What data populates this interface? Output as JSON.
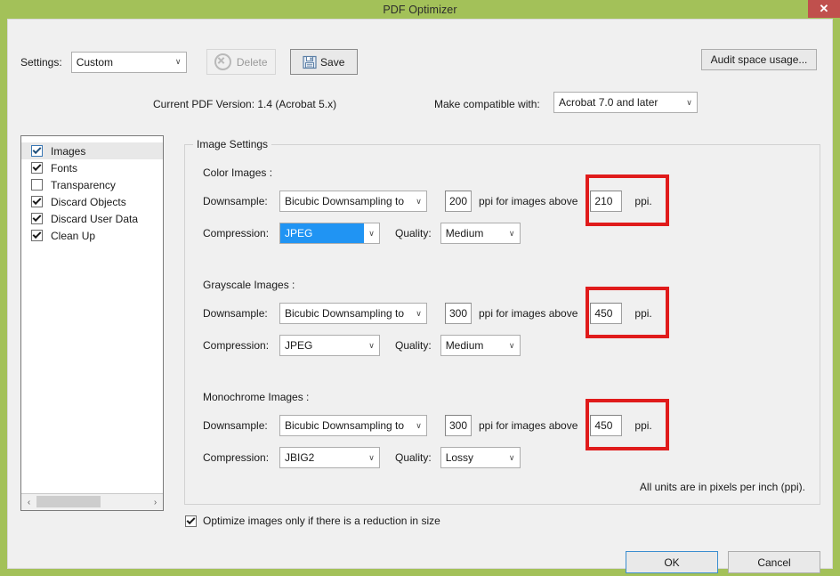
{
  "window": {
    "title": "PDF Optimizer",
    "close_label": "✕",
    "frame_color": "#a3c159",
    "close_color": "#c0504d"
  },
  "toolbar": {
    "settings_label": "Settings:",
    "settings_value": "Custom",
    "delete_label": "Delete",
    "delete_icon": "cancel-circle-icon",
    "save_label": "Save",
    "save_icon": "floppy-disk-icon",
    "audit_label": "Audit space usage..."
  },
  "version": {
    "current_text": "Current PDF Version: 1.4 (Acrobat 5.x)",
    "compat_label": "Make compatible with:",
    "compat_value": "Acrobat 7.0 and later"
  },
  "panel": {
    "items": [
      {
        "label": "Images",
        "checked": true,
        "selected": true
      },
      {
        "label": "Fonts",
        "checked": true,
        "selected": false
      },
      {
        "label": "Transparency",
        "checked": false,
        "selected": false
      },
      {
        "label": "Discard Objects",
        "checked": true,
        "selected": false
      },
      {
        "label": "Discard User Data",
        "checked": true,
        "selected": false
      },
      {
        "label": "Clean Up",
        "checked": true,
        "selected": false
      }
    ],
    "scroll_left": "‹",
    "scroll_right": "›"
  },
  "image_settings": {
    "legend": "Image Settings",
    "downsample_label": "Downsample:",
    "compression_label": "Compression:",
    "quality_label": "Quality:",
    "ppi_mid_text": "ppi for images above",
    "ppi_suffix": "ppi.",
    "units_note": "All units are in pixels per inch (ppi).",
    "sections": [
      {
        "title": "Color Images :",
        "downsample_method": "Bicubic Downsampling to",
        "downsample_ppi": "200",
        "threshold_ppi": "210",
        "compression": "JPEG",
        "compression_selected": true,
        "quality": "Medium",
        "highlighted": true
      },
      {
        "title": "Grayscale Images :",
        "downsample_method": "Bicubic Downsampling to",
        "downsample_ppi": "300",
        "threshold_ppi": "450",
        "compression": "JPEG",
        "compression_selected": false,
        "quality": "Medium",
        "highlighted": true
      },
      {
        "title": "Monochrome Images :",
        "downsample_method": "Bicubic Downsampling to",
        "downsample_ppi": "300",
        "threshold_ppi": "450",
        "compression": "JBIG2",
        "compression_selected": false,
        "quality": "Lossy",
        "highlighted": true
      }
    ]
  },
  "footer": {
    "optimize_label": "Optimize images only if there is a reduction in size",
    "optimize_checked": true,
    "ok_label": "OK",
    "cancel_label": "Cancel"
  },
  "colors": {
    "selection_blue": "#2094f3",
    "annotation_red": "#e01b1b",
    "title_green": "#a3c159"
  },
  "icons": {
    "combo_arrow": "∨"
  }
}
